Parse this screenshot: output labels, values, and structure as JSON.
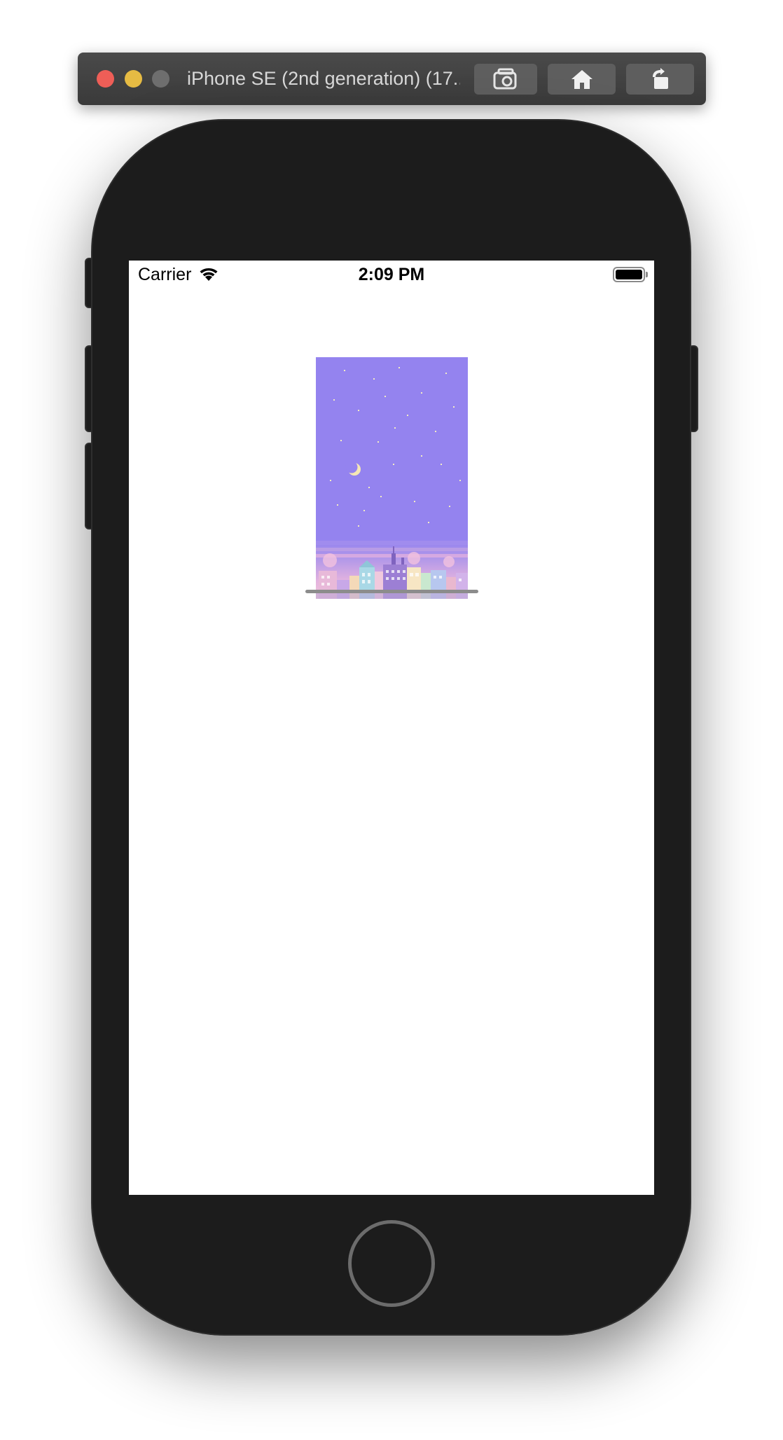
{
  "window": {
    "title": "iPhone SE (2nd generation) (17...",
    "buttons": {
      "screenshot_icon": "camera-icon",
      "home_icon": "home-icon",
      "rotate_icon": "rotate-icon"
    },
    "colors": {
      "close": "#ee5e57",
      "minimize": "#e6bb43",
      "zoom": "#6e6e6e"
    }
  },
  "statusbar": {
    "carrier": "Carrier",
    "time": "2:09 PM",
    "wifi_icon": "wifi-icon",
    "battery_icon": "battery-icon",
    "battery_level": 1.0
  },
  "content": {
    "image_description_colors": {
      "sky": "#9483ef",
      "horizon": "#e8b6e0"
    }
  }
}
